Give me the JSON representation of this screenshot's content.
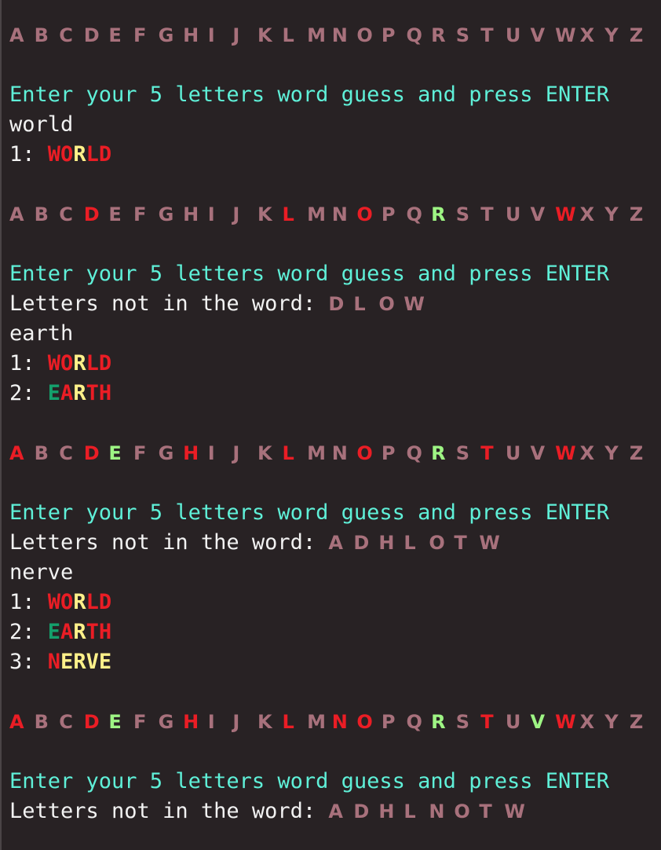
{
  "colors": {
    "background": "#282224",
    "text": "#f2f2f2",
    "prompt": "#5ff0d8",
    "unused": "#a8717c",
    "absent": "#ea1d25",
    "present": "#fff18a",
    "correct": "#9ef584",
    "correct_guess": "#14a06c"
  },
  "prompt_text": "Enter your 5 letters word guess and press ENTER",
  "not_in_label": "Letters not in the word: ",
  "blocks": [
    {
      "alphabet": [
        "A:none",
        "B:none",
        "C:none",
        "D:none",
        "E:none",
        "F:none",
        "G:none",
        "H:none",
        "I:none",
        "J:none",
        "K:none",
        "L:none",
        "M:none",
        "N:none",
        "O:none",
        "P:none",
        "Q:none",
        "R:none",
        "S:none",
        "T:none",
        "U:none",
        "V:none",
        "W:none",
        "X:none",
        "Y:none",
        "Z:none"
      ],
      "prompt": "Enter your 5 letters word guess and press ENTER",
      "not_in": null,
      "input": "world",
      "history": [
        {
          "num": "1: ",
          "letters": [
            [
              "W",
              "absent"
            ],
            [
              "O",
              "absent"
            ],
            [
              "R",
              "present"
            ],
            [
              "L",
              "absent"
            ],
            [
              "D",
              "absent"
            ]
          ]
        }
      ]
    },
    {
      "alphabet": [
        "A:none",
        "B:none",
        "C:none",
        "D:absent",
        "E:none",
        "F:none",
        "G:none",
        "H:none",
        "I:none",
        "J:none",
        "K:none",
        "L:absent",
        "M:none",
        "N:none",
        "O:absent",
        "P:none",
        "Q:none",
        "R:correct",
        "S:none",
        "T:none",
        "U:none",
        "V:none",
        "W:absent",
        "X:none",
        "Y:none",
        "Z:none"
      ],
      "prompt": "Enter your 5 letters word guess and press ENTER",
      "not_in": [
        "D",
        "L",
        "O",
        "W"
      ],
      "input": "earth",
      "history": [
        {
          "num": "1: ",
          "letters": [
            [
              "W",
              "absent"
            ],
            [
              "O",
              "absent"
            ],
            [
              "R",
              "present"
            ],
            [
              "L",
              "absent"
            ],
            [
              "D",
              "absent"
            ]
          ]
        },
        {
          "num": "2: ",
          "letters": [
            [
              "E",
              "correct-dark"
            ],
            [
              "A",
              "absent"
            ],
            [
              "R",
              "present"
            ],
            [
              "T",
              "absent"
            ],
            [
              "H",
              "absent"
            ]
          ]
        }
      ]
    },
    {
      "alphabet": [
        "A:absent",
        "B:none",
        "C:none",
        "D:absent",
        "E:correct",
        "F:none",
        "G:none",
        "H:absent",
        "I:none",
        "J:none",
        "K:none",
        "L:absent",
        "M:none",
        "N:none",
        "O:absent",
        "P:none",
        "Q:none",
        "R:correct",
        "S:none",
        "T:absent",
        "U:none",
        "V:none",
        "W:absent",
        "X:none",
        "Y:none",
        "Z:none"
      ],
      "prompt": "Enter your 5 letters word guess and press ENTER",
      "not_in": [
        "A",
        "D",
        "H",
        "L",
        "O",
        "T",
        "W"
      ],
      "input": "nerve",
      "history": [
        {
          "num": "1: ",
          "letters": [
            [
              "W",
              "absent"
            ],
            [
              "O",
              "absent"
            ],
            [
              "R",
              "present"
            ],
            [
              "L",
              "absent"
            ],
            [
              "D",
              "absent"
            ]
          ]
        },
        {
          "num": "2: ",
          "letters": [
            [
              "E",
              "correct-dark"
            ],
            [
              "A",
              "absent"
            ],
            [
              "R",
              "present"
            ],
            [
              "T",
              "absent"
            ],
            [
              "H",
              "absent"
            ]
          ]
        },
        {
          "num": "3: ",
          "letters": [
            [
              "N",
              "absent"
            ],
            [
              "E",
              "present"
            ],
            [
              "R",
              "present"
            ],
            [
              "V",
              "present"
            ],
            [
              "E",
              "present"
            ]
          ]
        }
      ]
    },
    {
      "alphabet": [
        "A:absent",
        "B:none",
        "C:none",
        "D:absent",
        "E:correct",
        "F:none",
        "G:none",
        "H:absent",
        "I:none",
        "J:none",
        "K:none",
        "L:absent",
        "M:none",
        "N:absent",
        "O:absent",
        "P:none",
        "Q:none",
        "R:correct",
        "S:none",
        "T:absent",
        "U:none",
        "V:correct",
        "W:absent",
        "X:none",
        "Y:none",
        "Z:none"
      ],
      "prompt": "Enter your 5 letters word guess and press ENTER",
      "not_in": [
        "A",
        "D",
        "H",
        "L",
        "N",
        "O",
        "T",
        "W"
      ],
      "input": null,
      "history": []
    }
  ]
}
